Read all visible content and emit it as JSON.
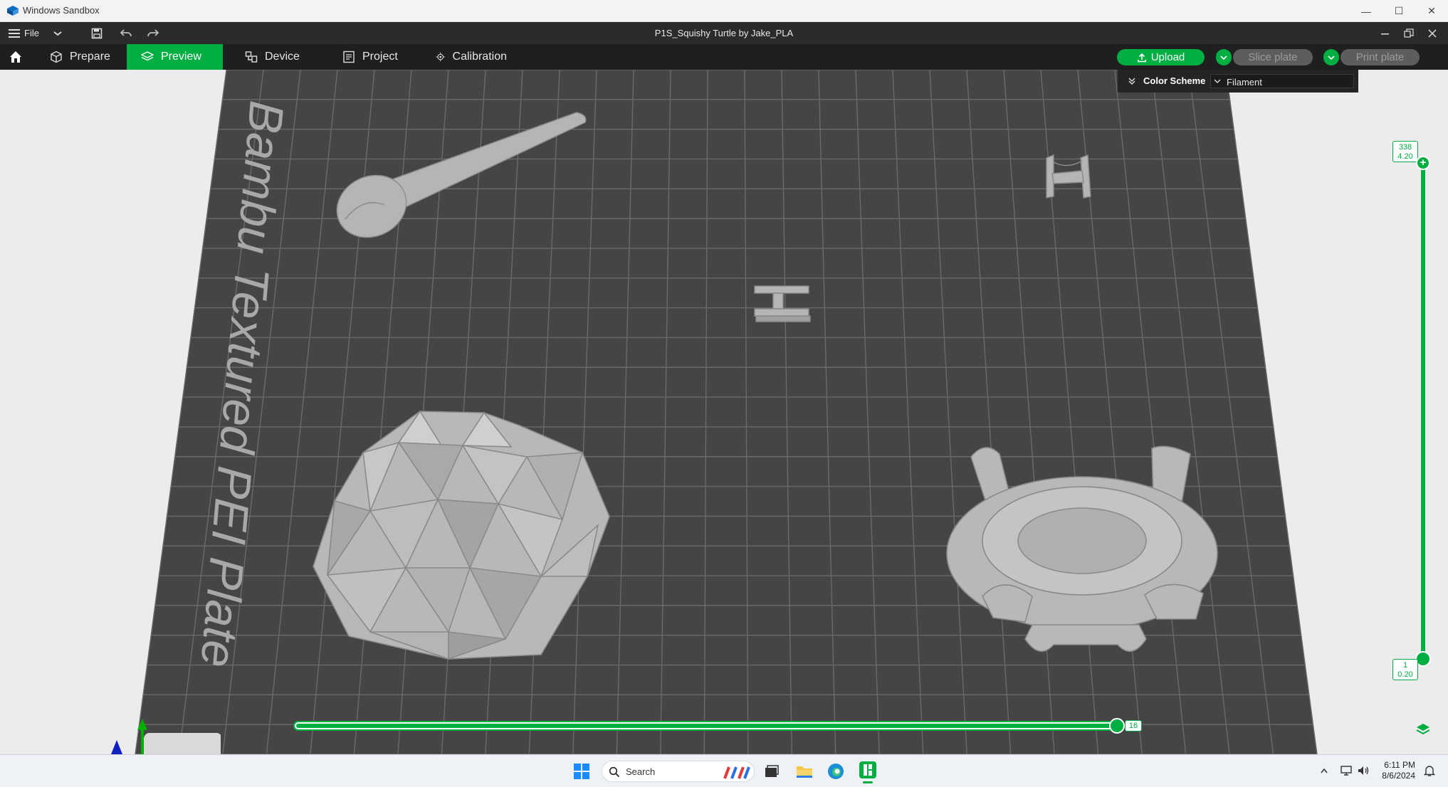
{
  "window": {
    "sandbox_title": "Windows Sandbox",
    "minimize": "—",
    "maximize": "☐",
    "close": "✕"
  },
  "menu": {
    "file_label": "File",
    "doc_title": "P1S_Squishy Turtle by Jake_PLA"
  },
  "tabs": [
    {
      "label": "Prepare",
      "icon": "cube-icon"
    },
    {
      "label": "Preview",
      "icon": "layers-icon",
      "active": true
    },
    {
      "label": "Device",
      "icon": "device-icon"
    },
    {
      "label": "Project",
      "icon": "project-icon"
    },
    {
      "label": "Calibration",
      "icon": "calibration-icon"
    }
  ],
  "actions": {
    "upload": "Upload",
    "slice_plate": "Slice plate",
    "print_plate": "Print plate"
  },
  "color_scheme": {
    "label": "Color Scheme",
    "value": "Filament"
  },
  "plate_label": "Bambu Textured PEI Plate",
  "layer_slider": {
    "top_layer": "338",
    "top_height": "4.20",
    "bottom_layer": "1",
    "bottom_height": "0.20"
  },
  "move_slider": {
    "value": "16",
    "fraction": 1.0
  },
  "taskbar": {
    "search_placeholder": "Search",
    "time": "6:11 PM",
    "date": "8/6/2024"
  },
  "colors": {
    "accent": "#00ae42",
    "bed": "#454545",
    "toolbar": "#1f1f1f"
  }
}
